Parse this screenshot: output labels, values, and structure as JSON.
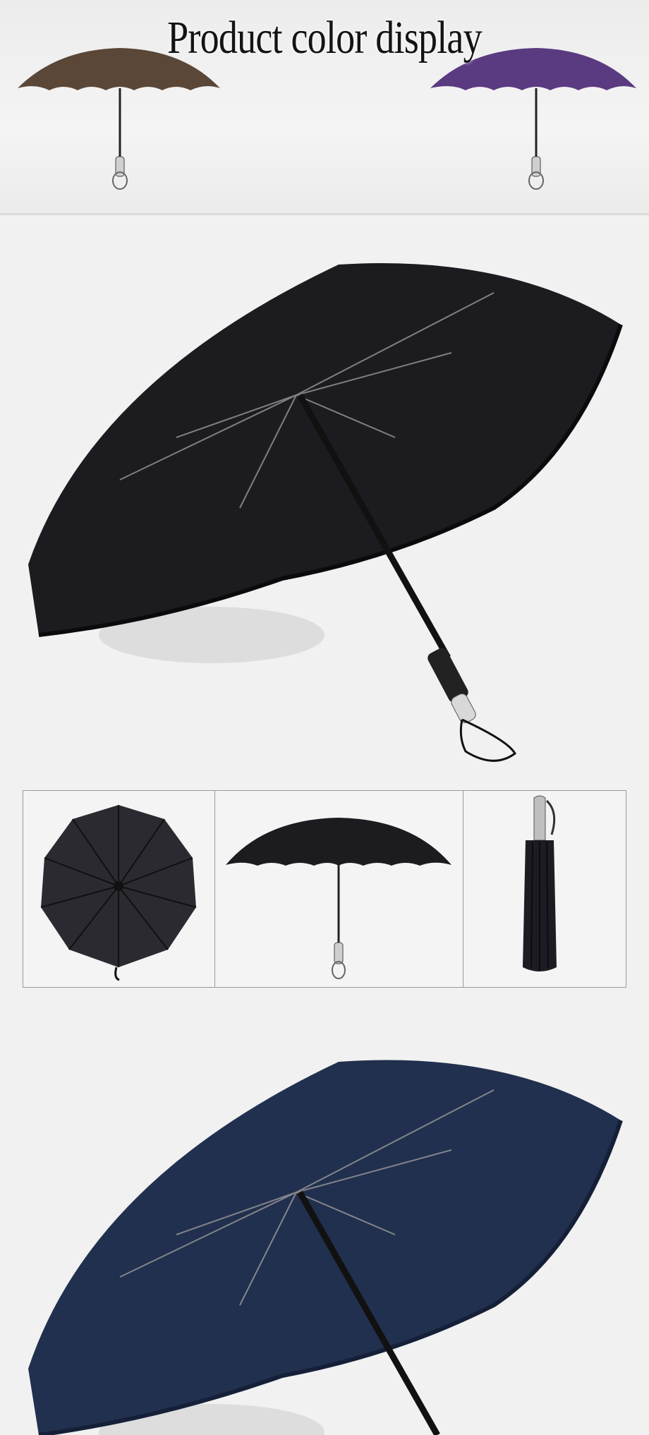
{
  "banner": {
    "title": "Product color display"
  },
  "colors": {
    "brown": "#5a4738",
    "purple": "#5a3a80",
    "black": "#1c1c20",
    "navy": "#22304f",
    "background": "#f1f1f1"
  },
  "views": [
    "open-angle",
    "top-view",
    "side-view",
    "folded"
  ]
}
